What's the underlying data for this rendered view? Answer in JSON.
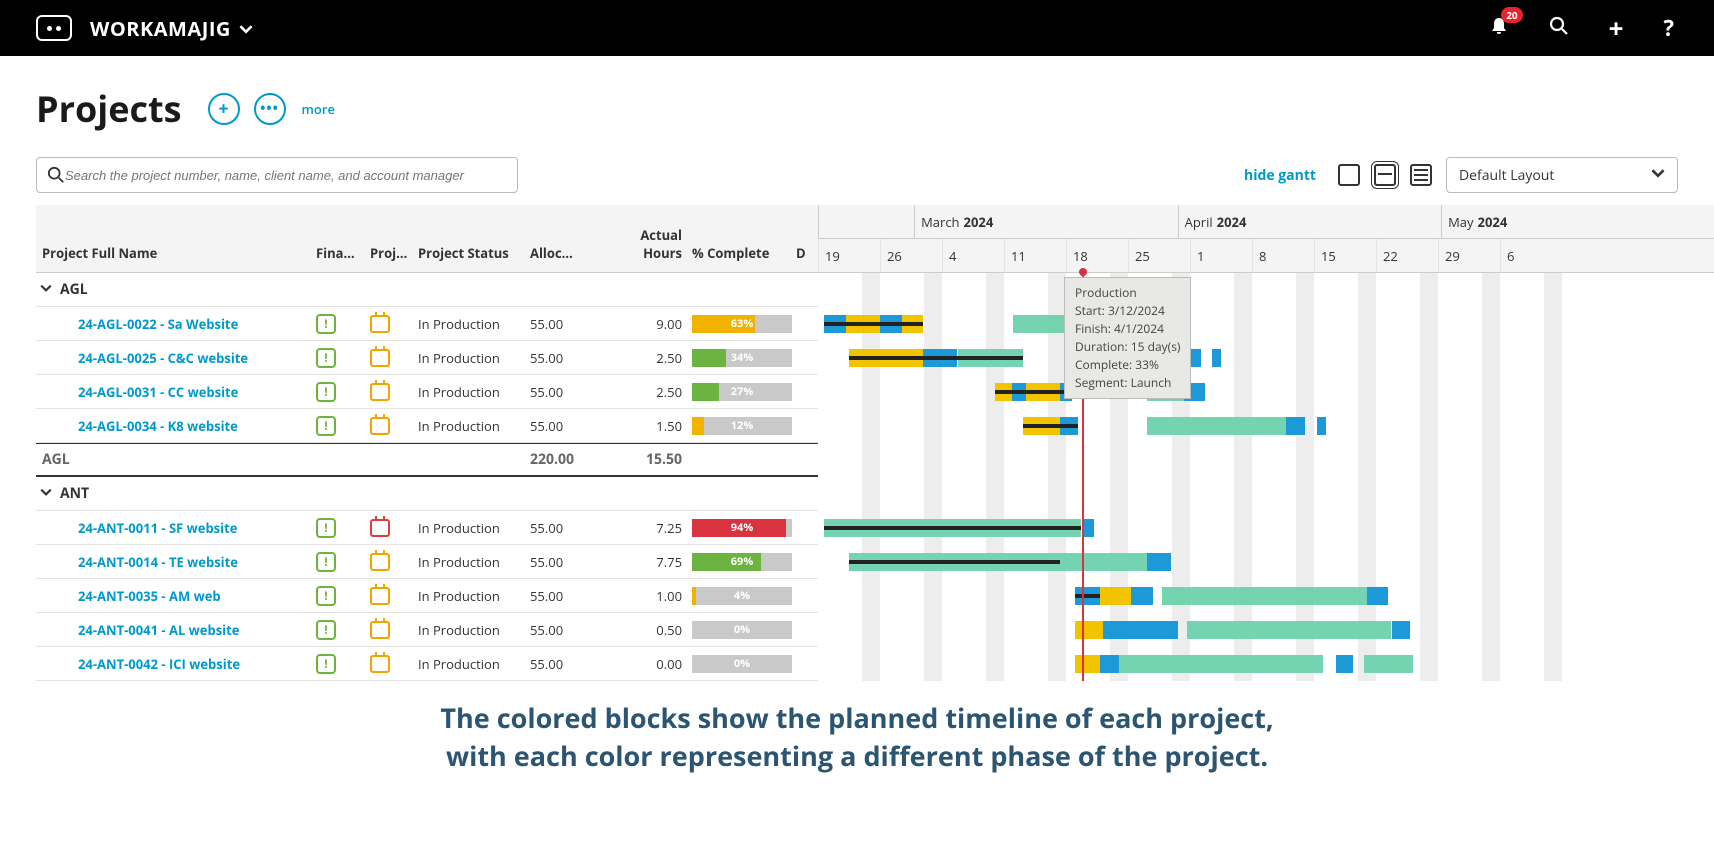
{
  "header": {
    "brand": "WORKAMAJIG",
    "badge": "20"
  },
  "page": {
    "title": "Projects",
    "more_label": "more",
    "search_placeholder": "Search the project number, name, client name, and account manager",
    "hide_gantt_label": "hide gantt",
    "layout_value": "Default Layout"
  },
  "columns": {
    "name": "Project Full Name",
    "fin": "Fina…",
    "prj": "Proj…",
    "status": "Project Status",
    "alloc": "Alloc…",
    "actual": "Actual Hours",
    "complete": "% Complete",
    "dx": "D"
  },
  "timeline": {
    "months": [
      {
        "label_a": "",
        "label_b": "",
        "width_days": 1.55
      },
      {
        "label_a": "March",
        "label_b": "2024",
        "width_days": 4.25
      },
      {
        "label_a": "April",
        "label_b": "2024",
        "width_days": 4.25
      },
      {
        "label_a": "May",
        "label_b": "2024",
        "width_days": 2
      }
    ],
    "days": [
      "19",
      "26",
      "4",
      "11",
      "18",
      "25",
      "1",
      "8",
      "15",
      "22",
      "29",
      "6"
    ],
    "day_width": 62,
    "today_index": 4.25
  },
  "groups": [
    {
      "name": "AGL",
      "rows": [
        {
          "link": "24-AGL-0022 - Sa   Website",
          "cal": "orange",
          "status": "In Production",
          "alloc": "55.00",
          "actual": "9.00",
          "pct": 63,
          "pcolor": "#f2b200",
          "segs": [
            {
              "x": 0.1,
              "w": 0.35,
              "c": "#1c99d6"
            },
            {
              "x": 0.45,
              "w": 0.55,
              "c": "#f2c400"
            },
            {
              "x": 1.0,
              "w": 0.35,
              "c": "#1c99d6"
            },
            {
              "x": 1.35,
              "w": 0.35,
              "c": "#f2c400"
            },
            {
              "x": 3.15,
              "w": 1.9,
              "c": "#74d3b0"
            },
            {
              "x": 5.05,
              "w": 0.35,
              "c": "#1c99d6"
            }
          ],
          "line": {
            "x": 0.1,
            "w": 1.6
          }
        },
        {
          "link": "24-AGL-0025 - C&C website",
          "cal": "orange",
          "status": "In Production",
          "alloc": "55.00",
          "actual": "2.50",
          "pct": 34,
          "pcolor": "#6db33f",
          "segs": [
            {
              "x": 0.5,
              "w": 1.2,
              "c": "#f2c400"
            },
            {
              "x": 1.7,
              "w": 0.55,
              "c": "#1c99d6"
            },
            {
              "x": 2.25,
              "w": 1.05,
              "c": "#74d3b0"
            },
            {
              "x": 5.3,
              "w": 0.55,
              "c": "#74d3b0"
            },
            {
              "x": 5.9,
              "w": 0.28,
              "c": "#1c99d6"
            },
            {
              "x": 6.35,
              "w": 0.15,
              "c": "#1c99d6"
            }
          ],
          "line": {
            "x": 0.5,
            "w": 2.8
          }
        },
        {
          "link": "24-AGL-0031 - CC   website",
          "cal": "orange",
          "status": "In Production",
          "alloc": "55.00",
          "actual": "2.50",
          "pct": 27,
          "pcolor": "#6db33f",
          "segs": [
            {
              "x": 2.85,
              "w": 0.28,
              "c": "#f2c400"
            },
            {
              "x": 3.13,
              "w": 0.22,
              "c": "#1c99d6"
            },
            {
              "x": 3.35,
              "w": 0.55,
              "c": "#f2c400"
            },
            {
              "x": 3.9,
              "w": 0.2,
              "c": "#1c99d6"
            },
            {
              "x": 5.3,
              "w": 0.6,
              "c": "#74d3b0"
            },
            {
              "x": 5.9,
              "w": 0.35,
              "c": "#1c99d6"
            }
          ],
          "line": {
            "x": 2.85,
            "w": 1.25
          }
        },
        {
          "link": "24-AGL-0034 - K8   website",
          "cal": "orange",
          "status": "In Production",
          "alloc": "55.00",
          "actual": "1.50",
          "pct": 12,
          "pcolor": "#f2b200",
          "segs": [
            {
              "x": 3.3,
              "w": 0.6,
              "c": "#f2c400"
            },
            {
              "x": 3.9,
              "w": 0.3,
              "c": "#1c99d6"
            },
            {
              "x": 5.3,
              "w": 2.25,
              "c": "#74d3b0"
            },
            {
              "x": 7.55,
              "w": 0.3,
              "c": "#1c99d6"
            },
            {
              "x": 8.05,
              "w": 0.15,
              "c": "#1c99d6"
            }
          ],
          "line": {
            "x": 3.3,
            "w": 0.9
          }
        }
      ],
      "total": {
        "label": "AGL",
        "alloc": "220.00",
        "actual": "15.50"
      }
    },
    {
      "name": "ANT",
      "rows": [
        {
          "link": "24-ANT-0011 - SF   website",
          "cal": "red",
          "status": "In Production",
          "alloc": "55.00",
          "actual": "7.25",
          "pct": 94,
          "pcolor": "#d9333f",
          "segs": [
            {
              "x": 0.1,
              "w": 4.15,
              "c": "#74d3b0"
            },
            {
              "x": 4.25,
              "w": 0.2,
              "c": "#1c99d6"
            }
          ],
          "line": {
            "x": 0.1,
            "w": 4.15
          }
        },
        {
          "link": "24-ANT-0014 - TE website",
          "cal": "orange",
          "status": "In Production",
          "alloc": "55.00",
          "actual": "7.75",
          "pct": 69,
          "pcolor": "#6db33f",
          "segs": [
            {
              "x": 0.5,
              "w": 4.8,
              "c": "#74d3b0"
            },
            {
              "x": 5.3,
              "w": 0.4,
              "c": "#1c99d6"
            }
          ],
          "line": {
            "x": 0.5,
            "w": 3.4
          }
        },
        {
          "link": "24-ANT-0035 - AM web",
          "cal": "orange",
          "status": "In Production",
          "alloc": "55.00",
          "actual": "1.00",
          "pct": 4,
          "pcolor": "#f2b200",
          "segs": [
            {
              "x": 4.15,
              "w": 0.4,
              "c": "#1c99d6"
            },
            {
              "x": 4.55,
              "w": 0.5,
              "c": "#f2c400"
            },
            {
              "x": 5.05,
              "w": 0.35,
              "c": "#1c99d6"
            },
            {
              "x": 5.55,
              "w": 3.3,
              "c": "#74d3b0"
            },
            {
              "x": 8.85,
              "w": 0.35,
              "c": "#1c99d6"
            }
          ],
          "line": {
            "x": 4.15,
            "w": 0.4
          }
        },
        {
          "link": "24-ANT-0041 - AL website",
          "cal": "orange",
          "status": "In Production",
          "alloc": "55.00",
          "actual": "0.50",
          "pct": 0,
          "pcolor": "#c9c9c9",
          "segs": [
            {
              "x": 4.15,
              "w": 0.45,
              "c": "#f2c400"
            },
            {
              "x": 4.6,
              "w": 1.2,
              "c": "#1c99d6"
            },
            {
              "x": 5.95,
              "w": 3.3,
              "c": "#74d3b0"
            },
            {
              "x": 9.25,
              "w": 0.3,
              "c": "#1c99d6"
            }
          ]
        },
        {
          "link": "24-ANT-0042 - ICI website",
          "cal": "orange",
          "status": "In Production",
          "alloc": "55.00",
          "actual": "0.00",
          "pct": 0,
          "pcolor": "#c9c9c9",
          "segs": [
            {
              "x": 4.15,
              "w": 0.4,
              "c": "#f2c400"
            },
            {
              "x": 4.55,
              "w": 3.6,
              "c": "#1c99d6"
            },
            {
              "x": 4.85,
              "w": 3.3,
              "c": "#74d3b0"
            },
            {
              "x": 8.35,
              "w": 0.28,
              "c": "#1c99d6"
            },
            {
              "x": 8.8,
              "w": 0.8,
              "c": "#74d3b0"
            }
          ]
        }
      ]
    }
  ],
  "tooltip": {
    "l1": "Production",
    "l2": "Start: 3/12/2024",
    "l3": "Finish: 4/1/2024",
    "l4": "Duration: 15 day(s)",
    "l5": "Complete: 33%",
    "l6": "Segment: Launch"
  },
  "caption": {
    "line1": "The colored blocks show the planned timeline of each project,",
    "line2": "with each color representing a different phase of the project."
  }
}
